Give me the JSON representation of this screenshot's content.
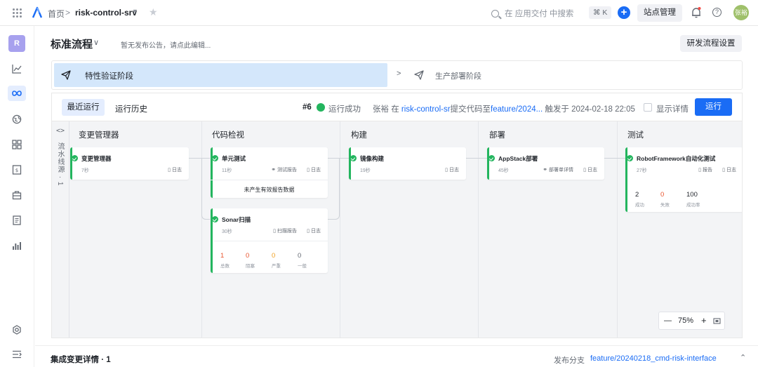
{
  "topbar": {
    "breadcrumb_home": "首页",
    "breadcrumb_sep": ">",
    "app_name": "risk-control-srv",
    "search_placeholder": "在 应用交付 中搜索",
    "search_shortcut": "⌘ K",
    "site_admin": "站点管理",
    "avatar_text": "张裕"
  },
  "rail": {
    "workspace_initial": "R"
  },
  "header": {
    "title": "标准流程",
    "notice": "暂无发布公告，请点此编辑...",
    "dev_settings": "研发流程设置"
  },
  "stages": [
    {
      "label": "特性验证阶段",
      "active": true
    },
    {
      "label": "生产部署阶段",
      "active": false
    }
  ],
  "runbar": {
    "tab_recent": "最近运行",
    "tab_history": "运行历史",
    "run_number": "#6",
    "status": "运行成功",
    "actor": "张裕 在 ",
    "repo": "risk-control-sr",
    "commit_text": "提交代码至",
    "branch": "feature/2024...",
    "trigger_text": " 触发于 2024-02-18 22:05",
    "show_detail": "显示详情",
    "run_button": "运行"
  },
  "canvas": {
    "lane_toggle": "<>",
    "lane_label": "流水线源 · 1",
    "columns": [
      "变更管理器",
      "代码检视",
      "构建",
      "部署",
      "测试"
    ],
    "cards": {
      "change_mgr": {
        "name": "变更管理器",
        "duration": "7秒",
        "log": "日志"
      },
      "unit_test": {
        "name": "单元测试",
        "duration": "11秒",
        "report": "测试报告",
        "log": "日志",
        "note": "未产生有效报告数据"
      },
      "sonar": {
        "name": "Sonar扫描",
        "duration": "30秒",
        "report": "扫描报告",
        "log": "日志",
        "stats": [
          {
            "value": "1",
            "label": "总数",
            "color": "#e8542e"
          },
          {
            "value": "0",
            "label": "阻塞",
            "color": "#e8542e"
          },
          {
            "value": "0",
            "label": "严重",
            "color": "#f0a020"
          },
          {
            "value": "0",
            "label": "一般",
            "color": "#646a73"
          }
        ]
      },
      "image_build": {
        "name": "镜像构建",
        "duration": "19秒",
        "log": "日志"
      },
      "appstack": {
        "name": "AppStack部署",
        "duration": "45秒",
        "detail": "部署单详情",
        "log": "日志"
      },
      "robot": {
        "name": "RobotFramework自动化测试",
        "duration": "27秒",
        "report": "报告",
        "log": "日志",
        "stats": [
          {
            "value": "2",
            "label": "成功",
            "color": "#1f2329"
          },
          {
            "value": "0",
            "label": "失败",
            "color": "#e8542e"
          },
          {
            "value": "100",
            "label": "成功率",
            "color": "#1f2329"
          }
        ]
      }
    },
    "zoom": {
      "minus": "—",
      "level": "75%",
      "plus": "+"
    }
  },
  "footer": {
    "title": "集成变更详情 · 1",
    "branch_label": "发布分支",
    "branch": "feature/20240218_cmd-risk-interface"
  },
  "colors": {
    "accent": "#1a6cf5",
    "success": "#23b55e",
    "stage_active": "#d4e7fb"
  }
}
